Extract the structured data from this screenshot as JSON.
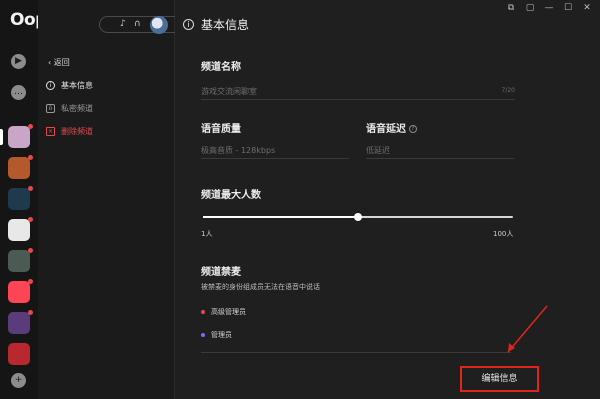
{
  "app": {
    "logo": "Oopz"
  },
  "window_controls": [
    "⧉",
    "▢",
    "—",
    "☐",
    "✕"
  ],
  "rail": {
    "top_icons": [
      "compass-icon",
      "chat-icon"
    ],
    "add_label": "+",
    "servers": [
      {
        "name": "server-anime",
        "color": "#c9a5c7",
        "dot": true
      },
      {
        "name": "server-game",
        "color": "#b3592b",
        "dot": true
      },
      {
        "name": "server-lol",
        "color": "#1e3a4c",
        "dot": true
      },
      {
        "name": "server-z",
        "color": "#e8e8e8",
        "dot": true
      },
      {
        "name": "server-character",
        "color": "#4b5a52",
        "dot": true
      },
      {
        "name": "server-valorant",
        "color": "#fd4556",
        "dot": true
      },
      {
        "name": "server-mix",
        "color": "#5a3c7a",
        "dot": true
      },
      {
        "name": "server-red",
        "color": "#b9282e",
        "dot": false
      }
    ]
  },
  "sidebar": {
    "back_label": "返回",
    "items": [
      {
        "label": "基本信息",
        "icon": "info-icon",
        "active": true,
        "color": "#e6e6e6"
      },
      {
        "label": "私密频道",
        "icon": "lock-user-icon",
        "active": false,
        "color": "#9a9a9a"
      },
      {
        "label": "删除频道",
        "icon": "delete-icon",
        "active": false,
        "color": "#e5484d"
      }
    ]
  },
  "header": {
    "title": "基本信息"
  },
  "form": {
    "channel_name": {
      "label": "频道名称",
      "placeholder": "游戏交流闲聊室",
      "counter": "7/20"
    },
    "voice_quality": {
      "label": "语音质量",
      "value": "极高音质 - 128kbps"
    },
    "voice_latency": {
      "label": "语音延迟",
      "value": "低延迟"
    },
    "max_users": {
      "label": "频道最大人数",
      "min_label": "1人",
      "max_label": "100人",
      "value_fraction": 0.5
    },
    "mute": {
      "label": "频道禁麦",
      "desc": "被禁麦的身份组成员无法在语音中说话",
      "roles": [
        {
          "label": "高级管理员",
          "color": "#e5484d"
        },
        {
          "label": "管理员",
          "color": "#7b6cf0"
        }
      ]
    }
  },
  "actions": {
    "edit_label": "编辑信息"
  },
  "colors": {
    "accent_red": "#e0251b"
  }
}
